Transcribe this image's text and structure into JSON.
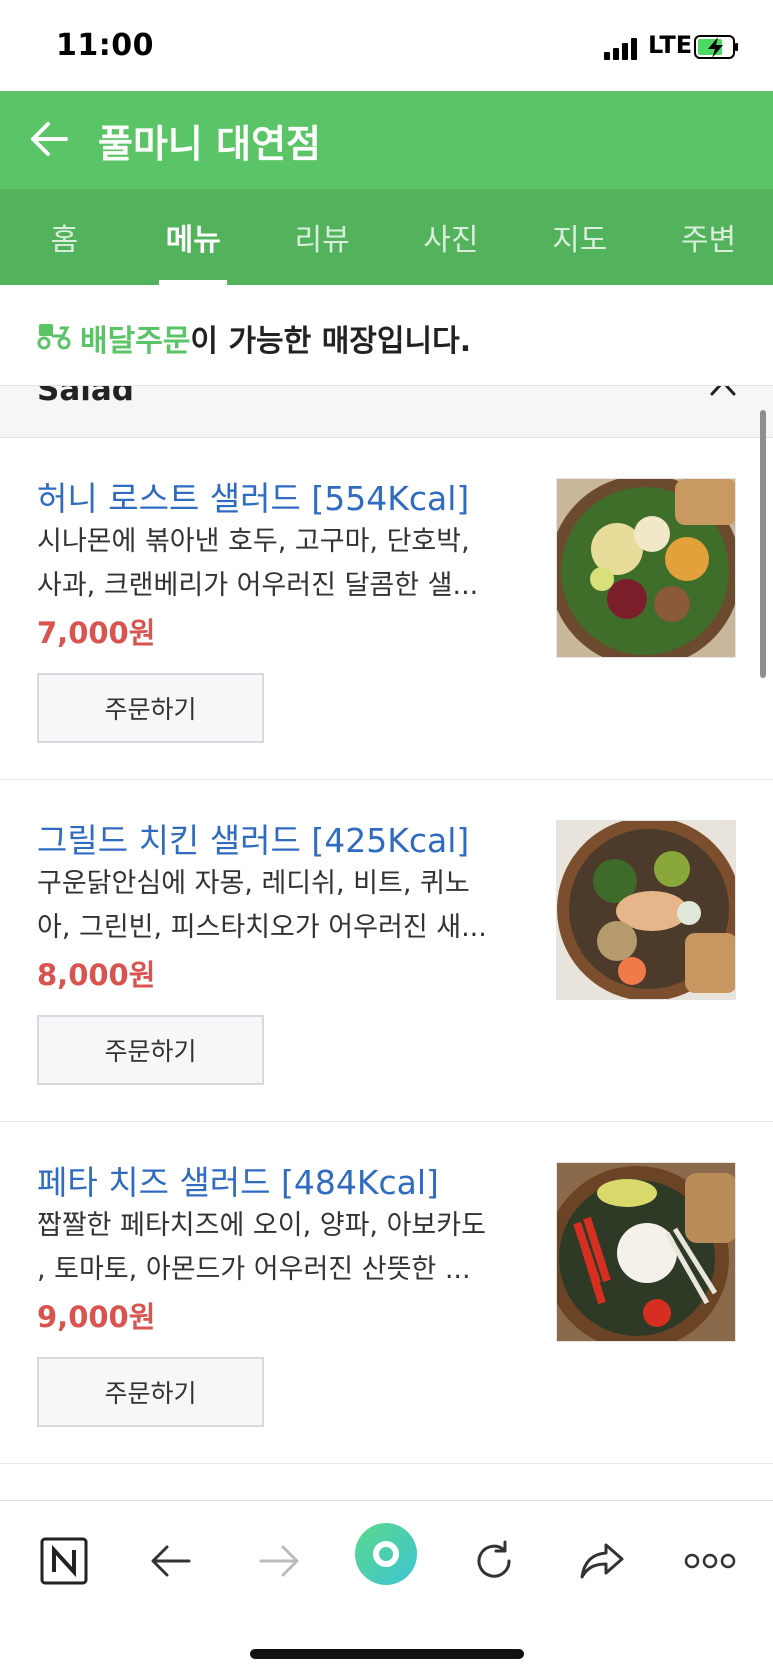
{
  "status_bar": {
    "time": "11:00",
    "network": "LTE"
  },
  "header": {
    "title": "풀마니 대연점"
  },
  "tabs": [
    {
      "label": "홈",
      "active": false
    },
    {
      "label": "메뉴",
      "active": true
    },
    {
      "label": "리뷰",
      "active": false
    },
    {
      "label": "사진",
      "active": false
    },
    {
      "label": "지도",
      "active": false
    },
    {
      "label": "주변",
      "active": false
    }
  ],
  "notice": {
    "highlight": "배달주문",
    "text": "이 가능한 매장입니다."
  },
  "section": {
    "title": "Salad"
  },
  "menu": [
    {
      "name": "허니 로스트 샐러드 [554Kcal]",
      "desc_line1": "시나몬에 볶아낸 호두, 고구마, 단호박,",
      "desc_line2": "사과, 크랜베리가 어우러진 달콤한 샐...",
      "price": "7,000원",
      "button": "주문하기"
    },
    {
      "name": "그릴드 치킨 샐러드 [425Kcal]",
      "desc_line1": "구운닭안심에 자몽, 레디쉬, 비트, 퀴노",
      "desc_line2": "아, 그린빈, 피스타치오가 어우러진 새...",
      "price": "8,000원",
      "button": "주문하기"
    },
    {
      "name": "페타 치즈 샐러드 [484Kcal]",
      "desc_line1": "짭짤한 페타치즈에 오이, 양파, 아보카도",
      "desc_line2": ", 토마토, 아몬드가 어우러진 산뜻한 ...",
      "price": "9,000원",
      "button": "주문하기"
    }
  ],
  "browser_bar": {
    "icons": [
      "naver-n-icon",
      "back-arrow-icon",
      "forward-arrow-icon",
      "green-dot-icon",
      "reload-icon",
      "share-icon",
      "more-icon"
    ]
  },
  "colors": {
    "header_green": "#5ac466",
    "tab_green": "#52b35c",
    "link_blue": "#2f6bc0",
    "price_red": "#d9534f"
  }
}
